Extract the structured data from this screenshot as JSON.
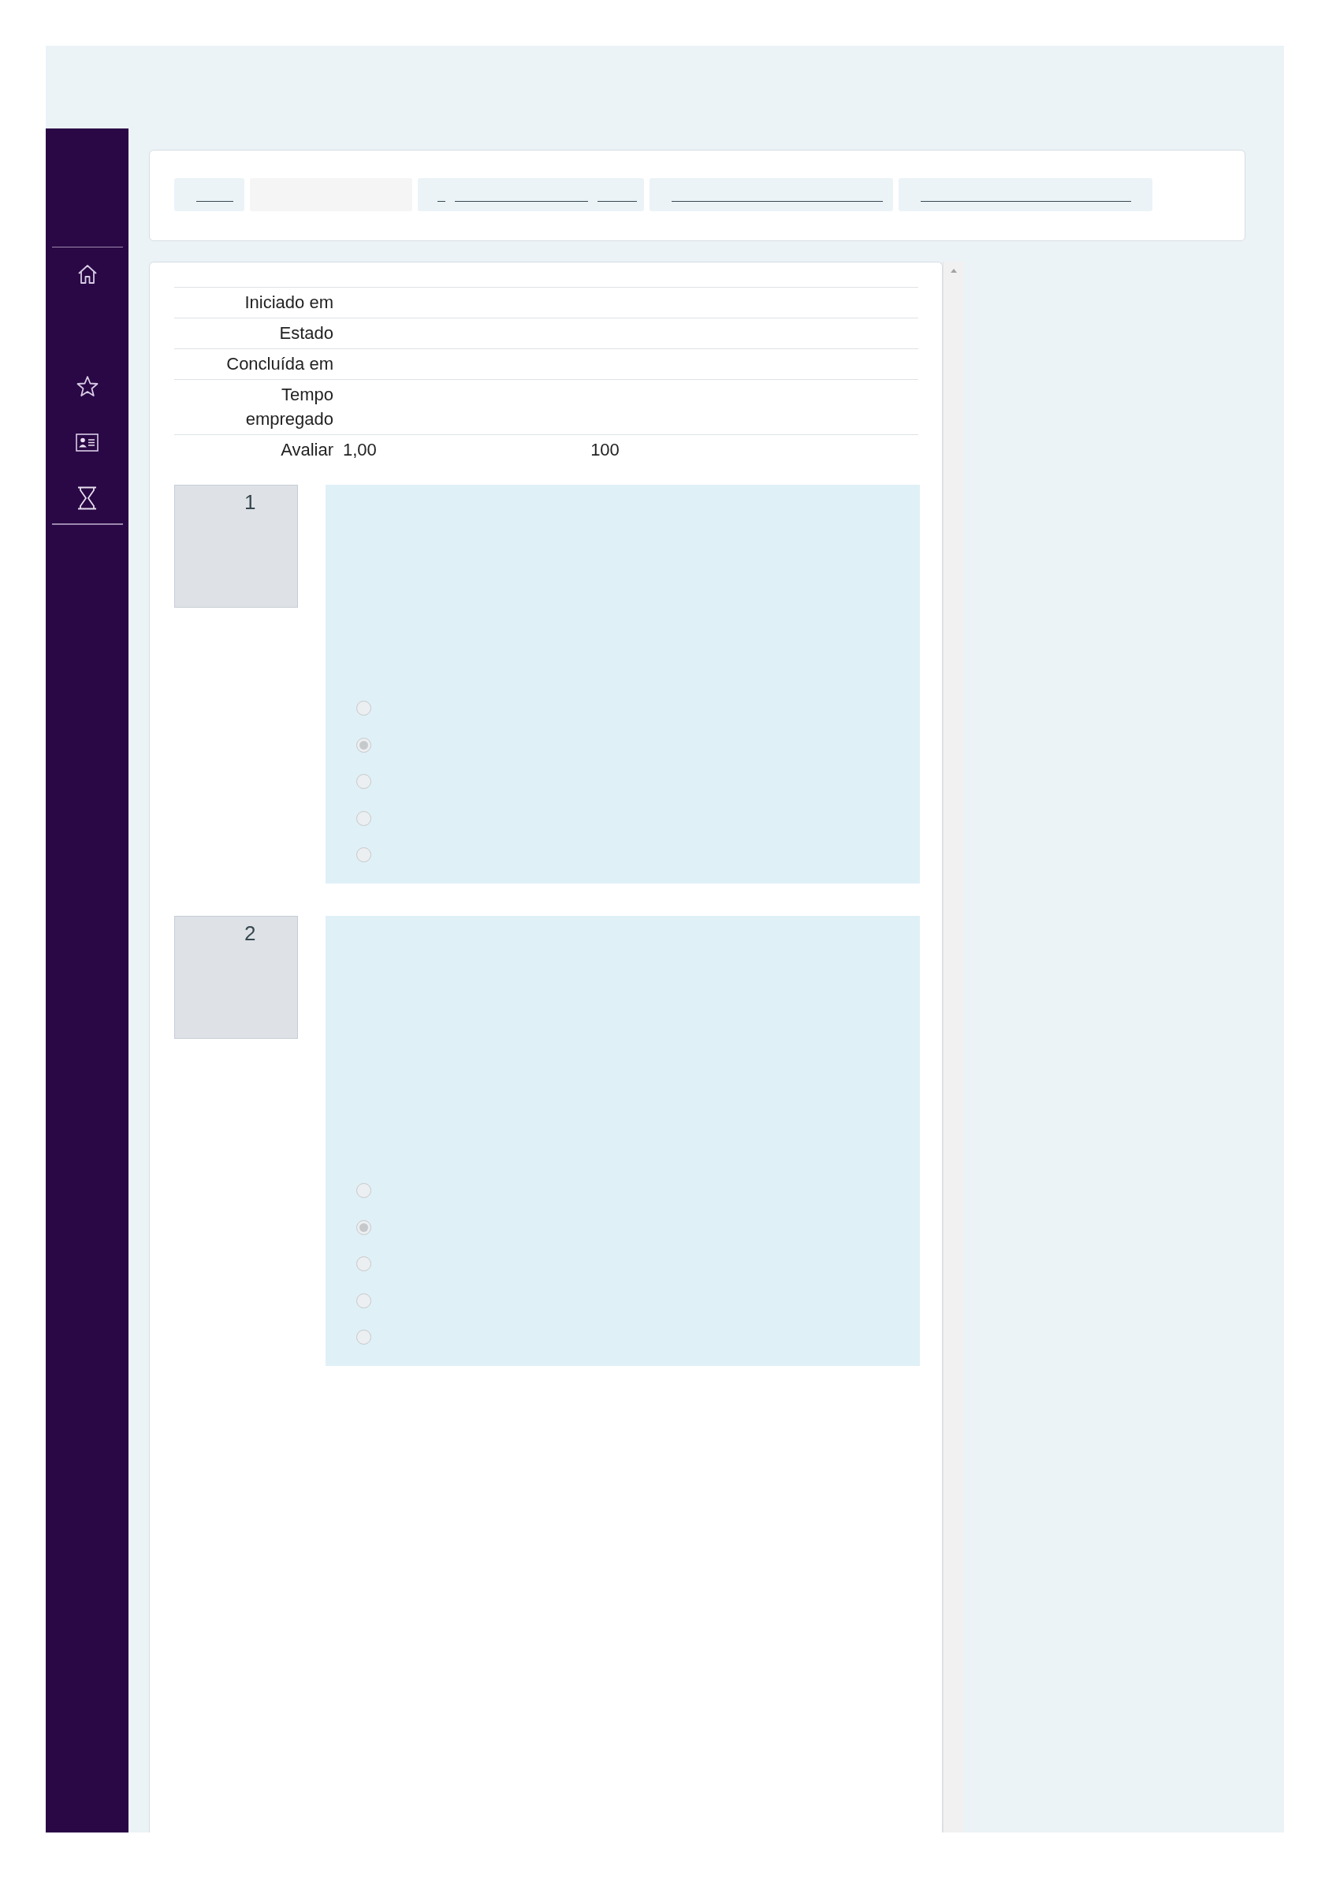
{
  "sidebar": {
    "items": [
      {
        "kind": "home"
      },
      {
        "kind": "star"
      },
      {
        "kind": "card"
      },
      {
        "kind": "hourglass"
      }
    ]
  },
  "breadcrumb": [
    {
      "kind": "link"
    },
    {
      "kind": "current"
    },
    {
      "kind": "link"
    },
    {
      "kind": "link"
    },
    {
      "kind": "link"
    }
  ],
  "summary": {
    "rows": [
      {
        "label": "Iniciado em"
      },
      {
        "label": "Estado"
      },
      {
        "label": "Concluída em"
      },
      {
        "label": "Tempo empregado"
      },
      {
        "label": "Avaliar",
        "value": "1,00",
        "extra": "100"
      }
    ]
  },
  "questions": [
    {
      "number": "1",
      "options": [
        {
          "selected": false
        },
        {
          "selected": true
        },
        {
          "selected": false
        },
        {
          "selected": false
        },
        {
          "selected": false
        }
      ]
    },
    {
      "number": "2",
      "options": [
        {
          "selected": false
        },
        {
          "selected": true
        },
        {
          "selected": false
        },
        {
          "selected": false
        },
        {
          "selected": false
        }
      ]
    }
  ]
}
